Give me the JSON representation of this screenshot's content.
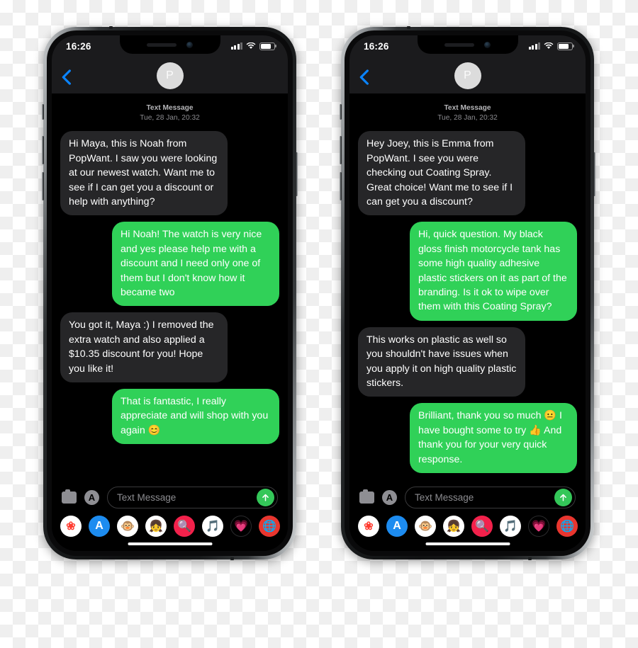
{
  "background": {
    "checker_light": "#ffffff",
    "checker_dark": "#efefef"
  },
  "colors": {
    "bubble_incoming": "#262628",
    "bubble_outgoing": "#30d158",
    "send_button": "#34c759",
    "back_chevron": "#0a84ff",
    "navbar": "#1b1b1d",
    "screen": "#000000",
    "avatar": "#dcdcdc"
  },
  "phones": [
    {
      "id": "phone-left",
      "status_bar": {
        "time": "16:26",
        "cellular_icon": "cellular-bars-icon",
        "wifi_icon": "wifi-icon",
        "battery_icon": "battery-icon",
        "battery_level_pct": 78
      },
      "navbar": {
        "back_icon": "back-chevron-icon",
        "avatar_initial": "P"
      },
      "timestamp": {
        "label": "Text Message",
        "datetime": "Tue, 28 Jan, 20:32"
      },
      "messages": [
        {
          "dir": "in",
          "text": "Hi Maya, this is Noah from PopWant. I saw you were looking at our newest watch. Want me to see if I can get you a discount or help with anything?"
        },
        {
          "dir": "out",
          "text": "Hi Noah! The watch is very nice and yes please help me with a discount and I need only one of them but I don't know how it became two"
        },
        {
          "dir": "in",
          "text": "You got it, Maya :) I removed the extra watch and also applied a $10.35 discount for you! Hope you like it!"
        },
        {
          "dir": "out",
          "text": "That is fantastic, I really appreciate and will shop with you again 😊"
        }
      ],
      "input_bar": {
        "camera_icon": "camera-icon",
        "appstore_icon": "app-store-icon",
        "placeholder": "Text Message",
        "value": "",
        "send_icon": "send-arrow-up-icon"
      },
      "app_drawer": [
        {
          "name": "photos-app-icon",
          "glyph": "❀",
          "bg": "#ffffff",
          "fg": "#ff3b30"
        },
        {
          "name": "app-store-app-icon",
          "glyph": "A",
          "bg": "#1d8cf0",
          "fg": "#ffffff"
        },
        {
          "name": "animoji-app-icon",
          "glyph": "🐵",
          "bg": "#ffffff",
          "fg": "#000000"
        },
        {
          "name": "memoji-app-icon",
          "glyph": "👧",
          "bg": "#ffffff",
          "fg": "#000000"
        },
        {
          "name": "images-search-app-icon",
          "glyph": "🔍",
          "bg": "#f2214b",
          "fg": "#ffffff"
        },
        {
          "name": "music-app-icon",
          "glyph": "🎵",
          "bg": "#ffffff",
          "fg": "#fc3c44"
        },
        {
          "name": "digital-touch-app-icon",
          "glyph": "💗",
          "bg": "#000000",
          "fg": "#ff4d6d"
        },
        {
          "name": "more-apps-icon",
          "glyph": "🌐",
          "bg": "#e8362f",
          "fg": "#ffffff"
        }
      ]
    },
    {
      "id": "phone-right",
      "status_bar": {
        "time": "16:26",
        "cellular_icon": "cellular-bars-icon",
        "wifi_icon": "wifi-icon",
        "battery_icon": "battery-icon",
        "battery_level_pct": 78
      },
      "navbar": {
        "back_icon": "back-chevron-icon",
        "avatar_initial": "P"
      },
      "timestamp": {
        "label": "Text Message",
        "datetime": "Tue, 28 Jan, 20:32"
      },
      "messages": [
        {
          "dir": "in",
          "text": "Hey Joey, this is Emma from PopWant. I see you were checking out Coating Spray. Great choice! Want me to see if I can get you a discount?"
        },
        {
          "dir": "out",
          "text": "Hi, quick question. My black gloss finish motorcycle tank has some high quality adhesive plastic stickers on it as part of the branding. Is it ok to wipe over them with this Coating Spray?"
        },
        {
          "dir": "in",
          "text": "This works on plastic as well so you shouldn't have issues when you apply it on high quality plastic stickers."
        },
        {
          "dir": "out",
          "text": "Brilliant, thank you so much 😐 I have bought some to try 👍 And thank you for your very quick response."
        }
      ],
      "input_bar": {
        "camera_icon": "camera-icon",
        "appstore_icon": "app-store-icon",
        "placeholder": "Text Message",
        "value": "",
        "send_icon": "send-arrow-up-icon"
      },
      "app_drawer": [
        {
          "name": "photos-app-icon",
          "glyph": "❀",
          "bg": "#ffffff",
          "fg": "#ff3b30"
        },
        {
          "name": "app-store-app-icon",
          "glyph": "A",
          "bg": "#1d8cf0",
          "fg": "#ffffff"
        },
        {
          "name": "animoji-app-icon",
          "glyph": "🐵",
          "bg": "#ffffff",
          "fg": "#000000"
        },
        {
          "name": "memoji-app-icon",
          "glyph": "👧",
          "bg": "#ffffff",
          "fg": "#000000"
        },
        {
          "name": "images-search-app-icon",
          "glyph": "🔍",
          "bg": "#f2214b",
          "fg": "#ffffff"
        },
        {
          "name": "music-app-icon",
          "glyph": "🎵",
          "bg": "#ffffff",
          "fg": "#fc3c44"
        },
        {
          "name": "digital-touch-app-icon",
          "glyph": "💗",
          "bg": "#000000",
          "fg": "#ff4d6d"
        },
        {
          "name": "more-apps-icon",
          "glyph": "🌐",
          "bg": "#e8362f",
          "fg": "#ffffff"
        }
      ]
    }
  ]
}
